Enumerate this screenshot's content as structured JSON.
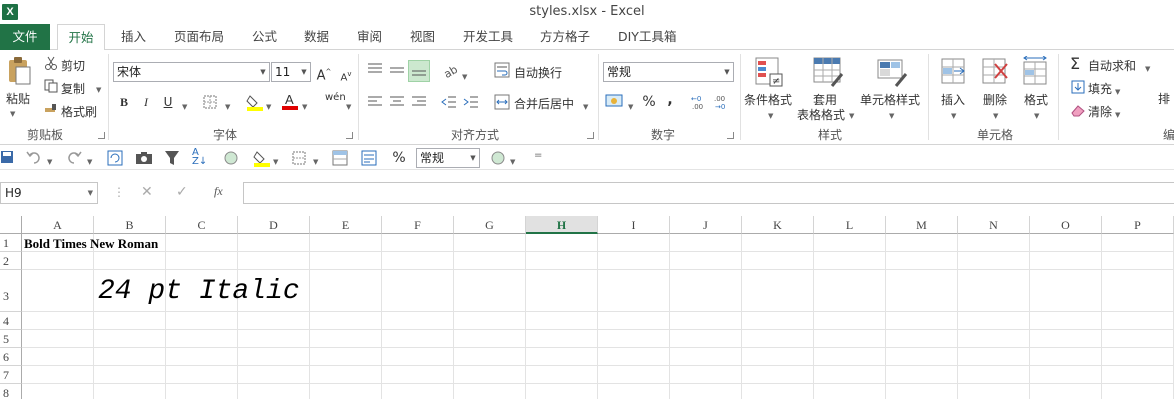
{
  "app": {
    "logo_letter": "X",
    "window_title": "styles.xlsx - Excel"
  },
  "tabs": [
    "文件",
    "开始",
    "插入",
    "页面布局",
    "公式",
    "数据",
    "审阅",
    "视图",
    "开发工具",
    "方方格子",
    "DIY工具箱"
  ],
  "ribbon": {
    "clipboard": {
      "paste": "粘贴",
      "cut": "剪切",
      "copy": "复制",
      "format_painter": "格式刷",
      "label": "剪贴板"
    },
    "font": {
      "font_name": "宋体",
      "font_size": "11",
      "bold": "B",
      "italic": "I",
      "underline": "U",
      "phonetic": "wén",
      "label": "字体"
    },
    "alignment": {
      "wrap_text": "自动换行",
      "merge_center": "合并后居中",
      "label": "对齐方式"
    },
    "number": {
      "format": "常规",
      "percent": "%",
      "comma": ",",
      "label": "数字"
    },
    "styles": {
      "conditional": "条件格式",
      "table_format_line1": "套用",
      "table_format_line2": "表格格式",
      "cell_styles": "单元格样式",
      "label": "样式"
    },
    "cells": {
      "insert": "插入",
      "delete": "删除",
      "format": "格式",
      "label": "单元格"
    },
    "editing": {
      "autosum": "自动求和",
      "fill": "填充",
      "clear": "清除",
      "sort_partial": "排",
      "label_partial": "编"
    }
  },
  "qat": {
    "number_format": "常规",
    "percent": "%"
  },
  "formula_bar": {
    "name_box": "H9",
    "fx": "fx",
    "content": ""
  },
  "grid": {
    "columns": [
      "A",
      "B",
      "C",
      "D",
      "E",
      "F",
      "G",
      "H",
      "I",
      "J",
      "K",
      "L",
      "M",
      "N",
      "O",
      "P"
    ],
    "active_column": "H",
    "rows": [
      "1",
      "2",
      "3",
      "4",
      "5",
      "6",
      "7",
      "8"
    ],
    "cells": {
      "A1": "Bold Times New Roman",
      "B3": "24 pt Italic"
    }
  },
  "colors": {
    "excel_green": "#217346",
    "font_color_red": "#e00000",
    "fill_yellow": "#ffff00"
  }
}
